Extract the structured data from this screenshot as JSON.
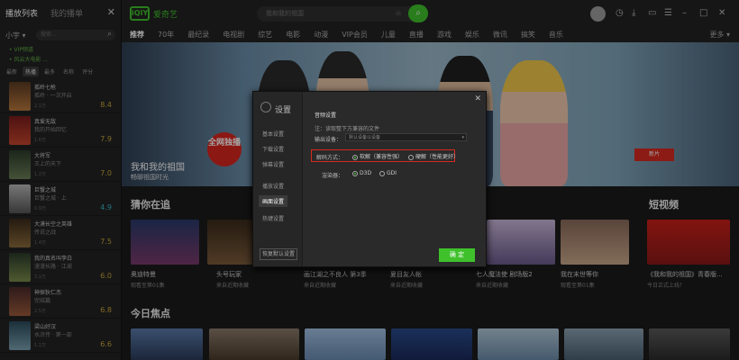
{
  "left": {
    "tab_playlist": "播放列表",
    "tab_mine": "我的播单",
    "user": "小宇 ▾",
    "search_placeholder": "搜索...",
    "vip_label": "• VIP频道",
    "vip_sub": "• 风云大电影 ...",
    "sort": [
      "最新",
      "热播",
      "最多",
      "名称",
      "评分"
    ],
    "items": [
      {
        "title": "孤岭七枪",
        "subtitle": "孤岭 · 一次开启",
        "meta": "2.1万",
        "score": "8.4"
      },
      {
        "title": "真爱无敌",
        "subtitle": "我的开始回忆",
        "meta": "1.6万",
        "score": "7.9"
      },
      {
        "title": "大将军",
        "subtitle": "王上的天下",
        "meta": "1.2万",
        "score": "7.0"
      },
      {
        "title": "巨蟹之城",
        "subtitle": "巨蟹之城 · 上",
        "meta": "0.9万",
        "score": "4.9"
      },
      {
        "title": "大漠长空之英雄",
        "subtitle": "传说之战",
        "meta": "1.4万",
        "score": "7.5"
      },
      {
        "title": "我的真名叫李白",
        "subtitle": "漫漫长路 · 江湖",
        "meta": "3.1万",
        "score": "6.0"
      },
      {
        "title": "神探狄仁杰",
        "subtitle": "完结篇",
        "meta": "2.5万",
        "score": "6.8"
      },
      {
        "title": "梁山好汉",
        "subtitle": "水浒传 · 第一部",
        "meta": "1.1万",
        "score": "6.6"
      }
    ]
  },
  "topbar": {
    "logo_mark": "iQIY",
    "logo_text": "爱奇艺",
    "search_placeholder": "我和我的祖国",
    "icons": [
      "clock-icon",
      "download-icon",
      "tv-icon",
      "menu-icon",
      "minimize-icon",
      "maximize-icon",
      "close-icon"
    ]
  },
  "nav": {
    "items": [
      "推荐",
      "70年",
      "最纪录",
      "电视剧",
      "综艺",
      "电影",
      "动漫",
      "VIP会员",
      "儿童",
      "直播",
      "游戏",
      "娱乐",
      "微讯",
      "搞笑",
      "音乐"
    ],
    "more": "更多 ▾"
  },
  "banner": {
    "caption": "我和我的祖国",
    "subcaption": "畅聊祖国时光",
    "badge": "全网独播",
    "tag": "新片"
  },
  "sections": {
    "guess": "猜你在追",
    "short": "短视频",
    "focus": "今日焦点"
  },
  "cards": [
    {
      "title": "奥迪特曼",
      "sub": "观看至第01集"
    },
    {
      "title": "头号玩家",
      "sub": "来自近期收藏"
    },
    {
      "title": "画江湖之不良人 第3季",
      "sub": "来自近期收藏"
    },
    {
      "title": "夏目友人帐",
      "sub": "来自近期收藏"
    },
    {
      "title": "七人魔法使 剧场版2",
      "sub": "来自近期收藏"
    },
    {
      "title": "我在末世等你",
      "sub": "观看至第01集"
    },
    {
      "title": "《我和我的祖国》青春版...",
      "sub": "今日正式上线！"
    }
  ],
  "modal": {
    "title": "设置",
    "menu": [
      "基本设置",
      "下载设置",
      "弹幕设置",
      "播放设置",
      "画面设置",
      "热键设置"
    ],
    "reset": "恢复默认设置",
    "audio_label": "音频设置",
    "audio_hint": "注：读取整下方兼容的文件",
    "output_label": "输出设备：",
    "output_value": "默认设备以设备",
    "decode_label": "解码方式：",
    "decode_soft": "软解（兼容性强）",
    "decode_hard": "硬解（性能更好）",
    "render_label": "渲染器：",
    "render_d3d": "D3D",
    "render_gdi": "GDI",
    "ok": "确 定"
  }
}
